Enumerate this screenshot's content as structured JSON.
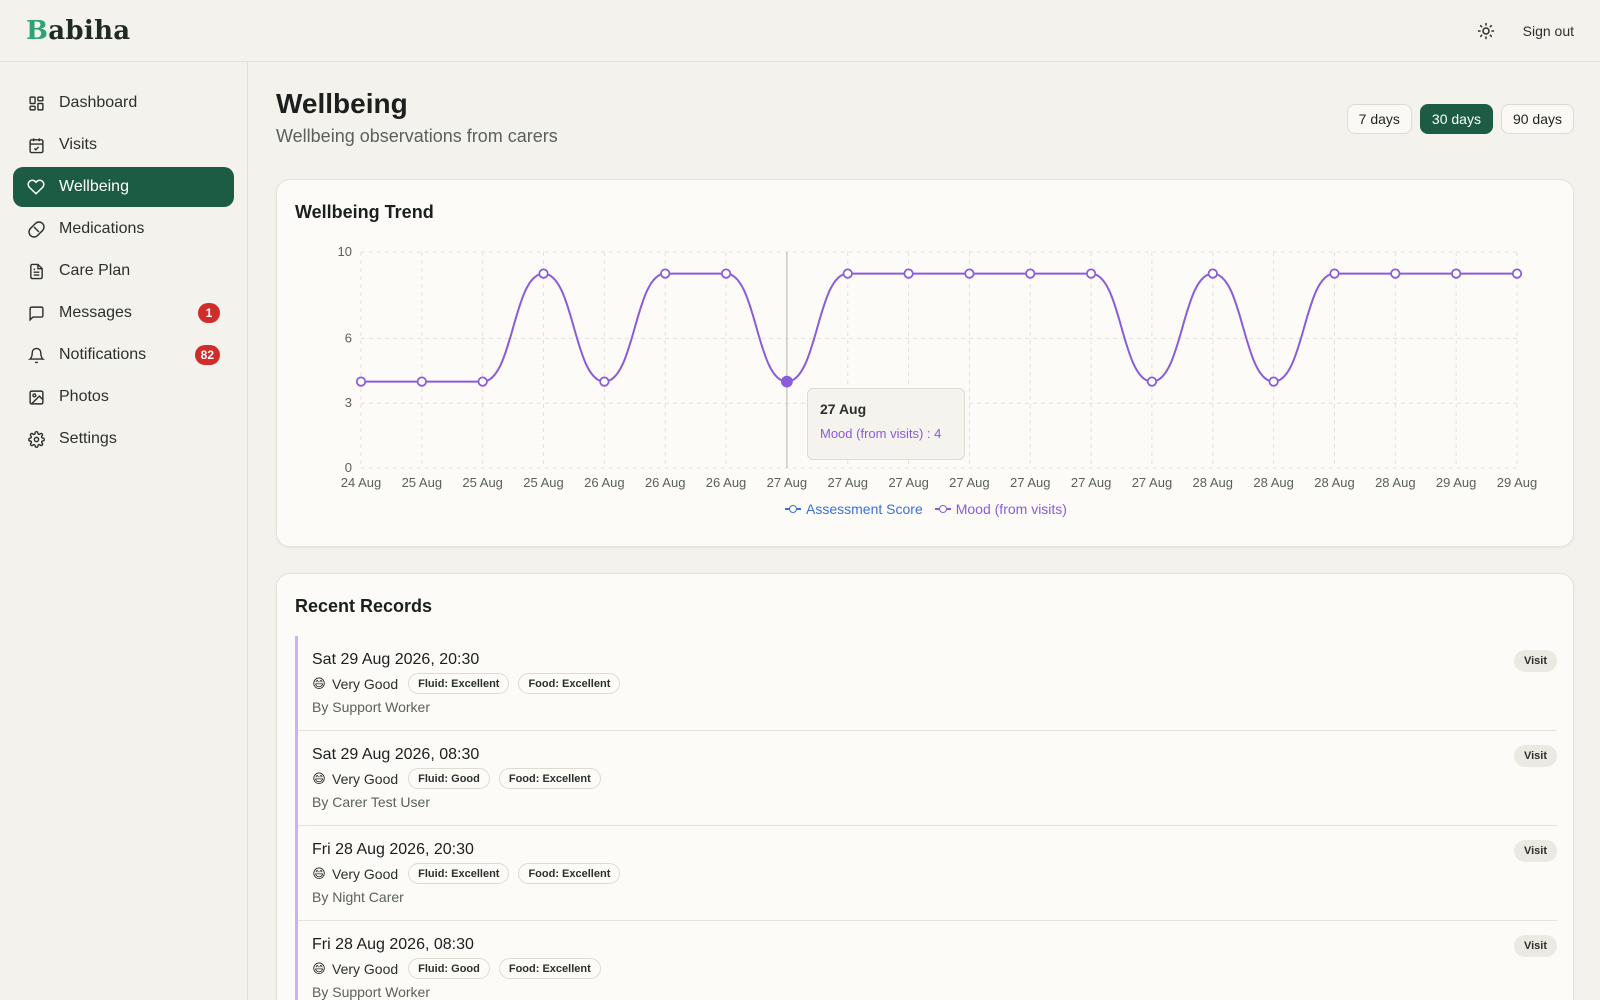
{
  "app": {
    "logo_initial": "B",
    "logo_rest": "abiha"
  },
  "topbar": {
    "sign_out_label": "Sign out",
    "theme_icon": "sun-icon"
  },
  "sidebar": {
    "items": [
      {
        "label": "Dashboard",
        "icon": "grid-icon"
      },
      {
        "label": "Visits",
        "icon": "calendar-check-icon"
      },
      {
        "label": "Wellbeing",
        "icon": "heart-icon",
        "active": true
      },
      {
        "label": "Medications",
        "icon": "pill-icon"
      },
      {
        "label": "Care Plan",
        "icon": "document-icon"
      },
      {
        "label": "Messages",
        "icon": "message-icon",
        "badge": "1"
      },
      {
        "label": "Notifications",
        "icon": "bell-icon",
        "badge": "82"
      },
      {
        "label": "Photos",
        "icon": "image-icon"
      },
      {
        "label": "Settings",
        "icon": "gear-icon"
      }
    ]
  },
  "page": {
    "title": "Wellbeing",
    "subtitle": "Wellbeing observations from carers",
    "ranges": [
      {
        "label": "7 days"
      },
      {
        "label": "30 days",
        "active": true
      },
      {
        "label": "90 days"
      }
    ]
  },
  "colors": {
    "accent": "#1c5c45",
    "mood_series": "#8a5cdb",
    "assessment_series": "#3b6fd8",
    "badge": "#d12c2c"
  },
  "chart_card": {
    "title": "Wellbeing Trend"
  },
  "chart_data": {
    "type": "line",
    "title": "Wellbeing Trend",
    "categories": [
      "24 Aug",
      "25 Aug",
      "25 Aug",
      "25 Aug",
      "26 Aug",
      "26 Aug",
      "26 Aug",
      "27 Aug",
      "27 Aug",
      "27 Aug",
      "27 Aug",
      "27 Aug",
      "27 Aug",
      "27 Aug",
      "28 Aug",
      "28 Aug",
      "28 Aug",
      "28 Aug",
      "29 Aug",
      "29 Aug"
    ],
    "series": [
      {
        "name": "Assessment Score",
        "values": []
      },
      {
        "name": "Mood (from visits)",
        "values": [
          4,
          4,
          4,
          9,
          4,
          9,
          9,
          4,
          9,
          9,
          9,
          9,
          9,
          4,
          9,
          4,
          9,
          9,
          9,
          9
        ]
      }
    ],
    "yticks": [
      0,
      3,
      6,
      10
    ],
    "ylim": [
      0,
      10
    ],
    "grid": true,
    "legend": "bottom",
    "tooltip": {
      "title": "27 Aug",
      "label": "Mood (from visits) : 4",
      "index": 7
    }
  },
  "records_card": {
    "title": "Recent Records",
    "records": [
      {
        "date": "Sat 29 Aug 2026, 20:30",
        "emoji": "😄",
        "mood": "Very Good",
        "fluid": "Fluid: Excellent",
        "food": "Food: Excellent",
        "by": "By Support Worker",
        "type": "Visit"
      },
      {
        "date": "Sat 29 Aug 2026, 08:30",
        "emoji": "😄",
        "mood": "Very Good",
        "fluid": "Fluid: Good",
        "food": "Food: Excellent",
        "by": "By Carer Test User",
        "type": "Visit"
      },
      {
        "date": "Fri 28 Aug 2026, 20:30",
        "emoji": "😄",
        "mood": "Very Good",
        "fluid": "Fluid: Excellent",
        "food": "Food: Excellent",
        "by": "By Night Carer",
        "type": "Visit"
      },
      {
        "date": "Fri 28 Aug 2026, 08:30",
        "emoji": "😄",
        "mood": "Very Good",
        "fluid": "Fluid: Good",
        "food": "Food: Excellent",
        "by": "By Support Worker",
        "type": "Visit"
      }
    ]
  }
}
